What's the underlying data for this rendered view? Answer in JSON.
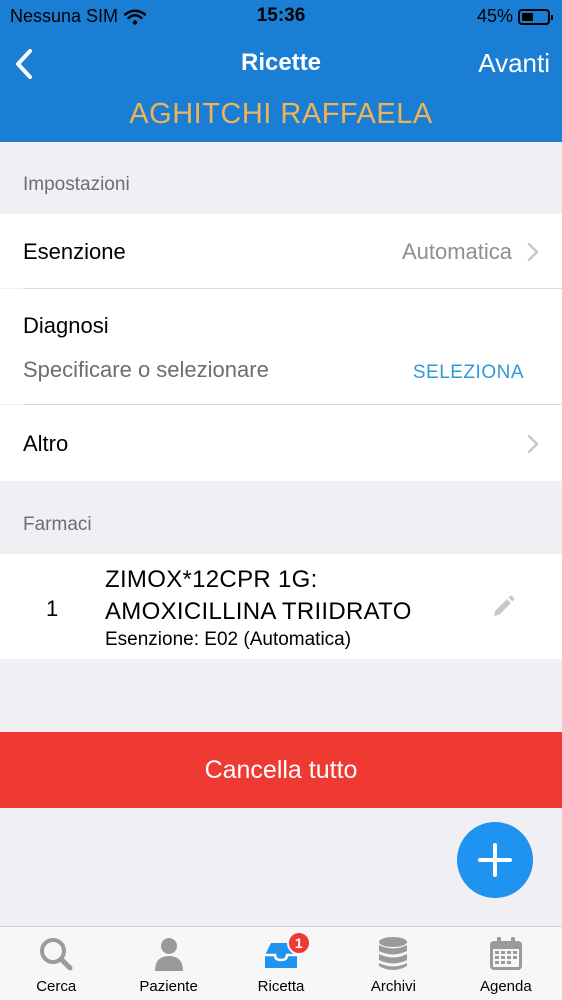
{
  "status": {
    "carrier": "Nessuna SIM",
    "time": "15:36",
    "battery_percent": "45%",
    "battery_level": 0.45
  },
  "nav": {
    "title": "Ricette",
    "next_label": "Avanti",
    "patient_name": "AGHITCHI RAFFAELA"
  },
  "settings": {
    "header": "Impostazioni",
    "exemption_label": "Esenzione",
    "exemption_value": "Automatica",
    "diagnosis_label": "Diagnosi",
    "diagnosis_placeholder": "Specificare o selezionare",
    "diagnosis_select": "SELEZIONA",
    "other_label": "Altro"
  },
  "drugs": {
    "header": "Farmaci",
    "items": [
      {
        "number": "1",
        "name_line1": "ZIMOX*12CPR 1G:",
        "name_line2": "AMOXICILLINA TRIIDRATO",
        "exemption": "Esenzione: E02 (Automatica)"
      }
    ]
  },
  "actions": {
    "cancel_all": "Cancella tutto"
  },
  "tabs": [
    {
      "label": "Cerca",
      "icon": "search-icon"
    },
    {
      "label": "Paziente",
      "icon": "person-icon"
    },
    {
      "label": "Ricetta",
      "icon": "tray-icon",
      "badge": "1"
    },
    {
      "label": "Archivi",
      "icon": "database-icon"
    },
    {
      "label": "Agenda",
      "icon": "calendar-icon"
    }
  ],
  "colors": {
    "nav_blue": "#1a7ed4",
    "patient_orange": "#f0b357",
    "danger_red": "#ee3a32",
    "fab_blue": "#1e93f0",
    "link_blue": "#2f9ad8"
  }
}
